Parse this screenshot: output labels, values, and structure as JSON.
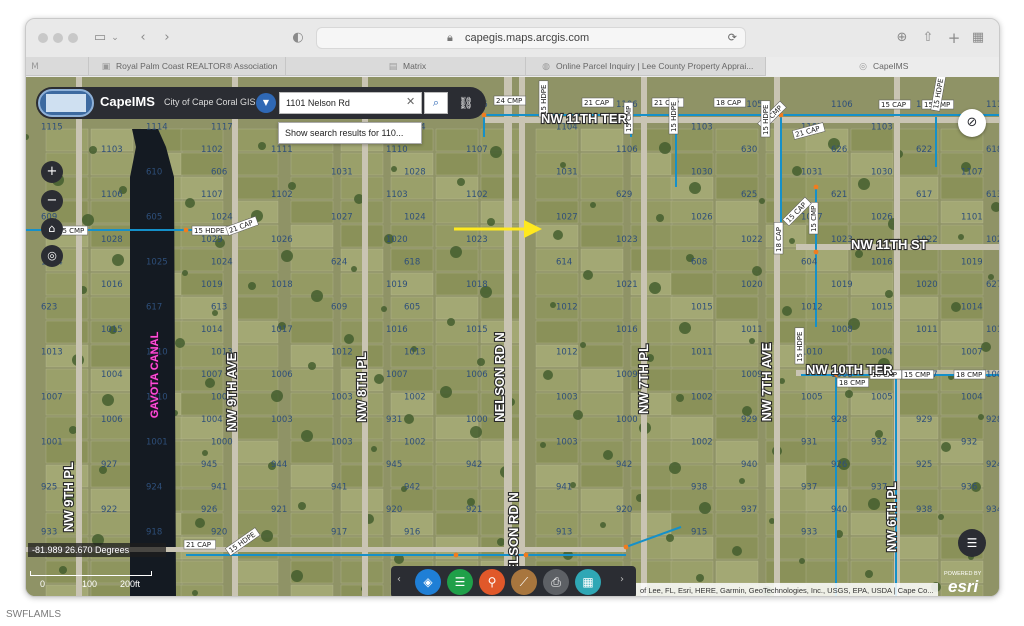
{
  "browser": {
    "url": "capegis.maps.arcgis.com",
    "tabs": [
      {
        "label": "Royal Palm Coast REALTOR® Association"
      },
      {
        "label": "Matrix"
      },
      {
        "label": "Online Parcel Inquiry | Lee County Property Apprai..."
      },
      {
        "label": "CapeIMS"
      }
    ]
  },
  "app": {
    "title": "CapeIMS",
    "subtitle": "City of Cape Coral GIS",
    "search_value": "1101 Nelson Rd",
    "suggestion": "Show search results for 110..."
  },
  "map": {
    "coords": "-81.989 26.670 Degrees",
    "scale": {
      "start": "0",
      "mid": "100",
      "end": "200ft"
    },
    "attribution": "of Lee, FL, Esri, HERE, Garmin, GeoTechnologies, Inc., USGS, EPA, USDA | Cape Co...",
    "esri_powered": "POWERED BY",
    "esri_brand": "esri",
    "roads": [
      "NW 11TH TER",
      "NW 11TH ST",
      "NW 10TH TER",
      "NELSON RD N",
      "NW 7TH PL",
      "NW 7TH AVE",
      "NW 6TH PL",
      "NW 8TH PL",
      "NW 9TH AVE",
      "NW 9TH PL"
    ],
    "canal": "GAVOTA CANAL",
    "utility_labels": [
      "24 CMP",
      "21 CAP",
      "21 CAP",
      "18 CAP",
      "15 HDPE",
      "15 CMP",
      "15 HDPE",
      "15 CMP",
      "15 HDPE",
      "21 CAP",
      "15 CAP",
      "15 CMP",
      "15 HDPE",
      "15 CMP",
      "15 CAP",
      "18 CAP",
      "15 CMP",
      "15 HDPE",
      "21 CAP",
      "18 CMP",
      "18 CAP",
      "15 CMP",
      "18 CMP",
      "15 HDPE",
      "21 CAP",
      "15 HDPE"
    ],
    "parcels": [
      "1108",
      "1106",
      "1104",
      "1107",
      "1106",
      "1106",
      "1105",
      "1106",
      "1107",
      "1110",
      "1115",
      "1114",
      "1117",
      "1112",
      "1114",
      "1104",
      "1103",
      "1102",
      "1103",
      "1102",
      "1103",
      "1102",
      "1111",
      "1110",
      "1107",
      "1106",
      "630",
      "626",
      "622",
      "618",
      "614",
      "610",
      "606",
      "1031",
      "1028",
      "1031",
      "1030",
      "1031",
      "1030",
      "1107",
      "1106",
      "1107",
      "1102",
      "1103",
      "1102",
      "629",
      "625",
      "621",
      "617",
      "613",
      "609",
      "605",
      "1024",
      "1027",
      "1024",
      "1027",
      "1026",
      "1027",
      "1026",
      "1101",
      "1028",
      "1029",
      "1026",
      "1020",
      "1023",
      "1023",
      "1022",
      "1023",
      "1022",
      "1027",
      "1024",
      "1025",
      "1024",
      "624",
      "618",
      "614",
      "608",
      "604",
      "1016",
      "1019",
      "1016",
      "1019",
      "1018",
      "1019",
      "1018",
      "1021",
      "1020",
      "1019",
      "1020",
      "627",
      "623",
      "617",
      "613",
      "609",
      "605",
      "1012",
      "1015",
      "1012",
      "1015",
      "1014",
      "1015",
      "1014",
      "1017",
      "1016",
      "1015",
      "1016",
      "1011",
      "1008",
      "1011",
      "1010",
      "1013",
      "1010",
      "1013",
      "1012",
      "1013",
      "1012",
      "1011",
      "1010",
      "1004",
      "1007",
      "1004",
      "1007",
      "1006",
      "1007",
      "1006",
      "1009",
      "1009",
      "1008",
      "1007",
      "1006",
      "1007",
      "1010",
      "1003",
      "1003",
      "1002",
      "1003",
      "1002",
      "1005",
      "1005",
      "1004",
      "1006",
      "1004",
      "1003",
      "931",
      "1000",
      "1000",
      "929",
      "928",
      "929",
      "928",
      "1001",
      "1001",
      "1000",
      "1003",
      "1002",
      "1003",
      "1002",
      "931",
      "932",
      "932",
      "927",
      "945",
      "944",
      "945",
      "942",
      "942",
      "940",
      "926",
      "925",
      "924",
      "925",
      "924",
      "941",
      "941",
      "942",
      "941",
      "938",
      "937",
      "937",
      "936",
      "922",
      "926",
      "921",
      "920",
      "921",
      "920",
      "937",
      "940",
      "938",
      "934",
      "933",
      "918",
      "920",
      "917",
      "916",
      "913",
      "915",
      "933"
    ]
  }
}
